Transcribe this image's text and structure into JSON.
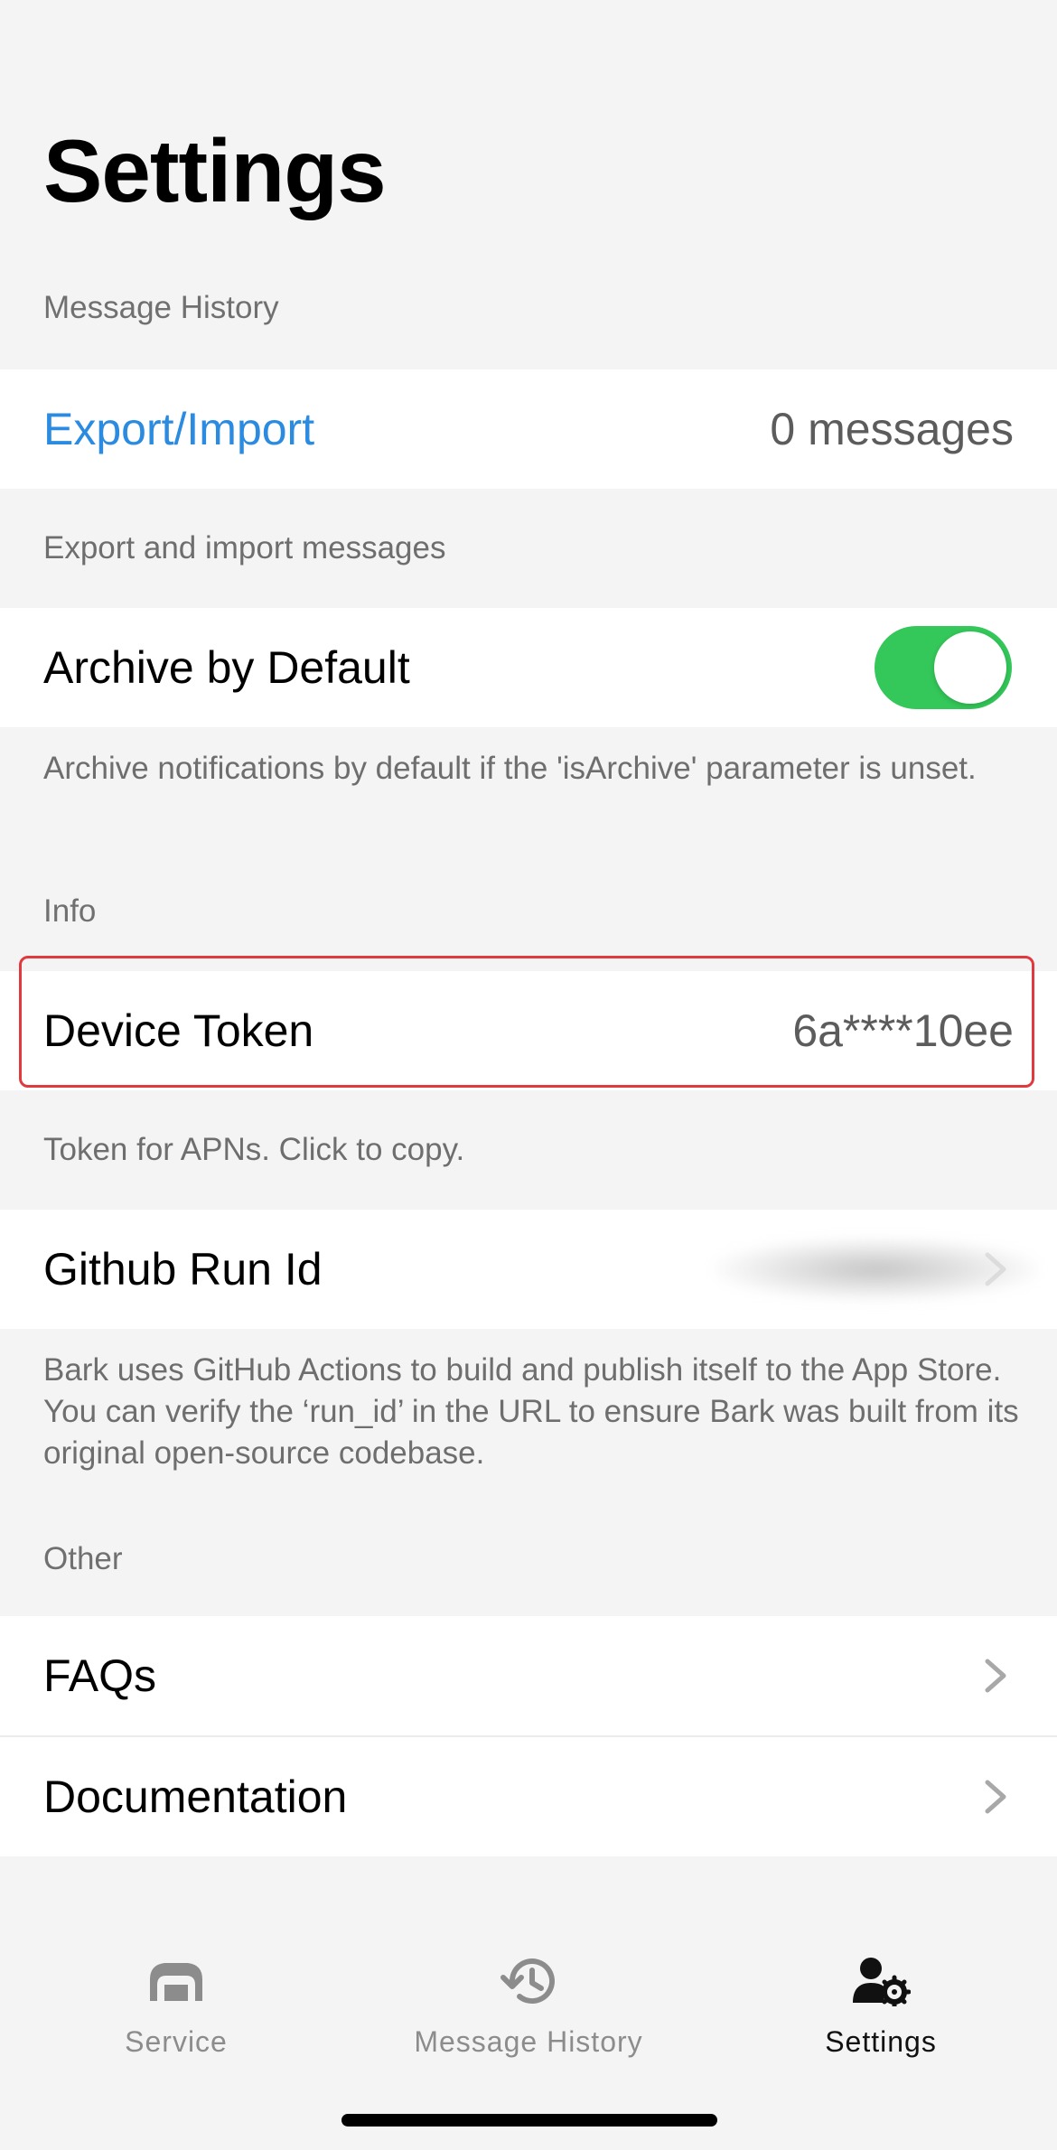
{
  "page": {
    "title": "Settings"
  },
  "sections": {
    "message_history": {
      "header": "Message History",
      "export_import_label": "Export/Import",
      "export_import_value": "0 messages",
      "export_footer": "Export and import messages",
      "archive_label": "Archive by Default",
      "archive_enabled": true,
      "archive_footer": "Archive notifications by default if the 'isArchive' parameter is unset."
    },
    "info": {
      "header": "Info",
      "device_token_label": "Device Token",
      "device_token_value": "6a****10ee",
      "device_token_footer": "Token for APNs. Click to copy.",
      "github_run_label": "Github Run Id",
      "github_run_footer": "Bark uses GitHub Actions to build and publish itself to the App Store. You can verify the ‘run_id’ in the URL to ensure Bark was built from its original open-source codebase."
    },
    "other": {
      "header": "Other",
      "faqs_label": "FAQs",
      "documentation_label": "Documentation"
    }
  },
  "tabbar": {
    "service_label": "Service",
    "message_history_label": "Message History",
    "settings_label": "Settings",
    "active": "settings"
  },
  "colors": {
    "accent_link": "#2a8be0",
    "toggle_on": "#34c759",
    "highlight_border": "#e0393e",
    "background": "#f4f4f4"
  },
  "icons": {
    "service": "service-icon",
    "message_history": "history-icon",
    "settings": "settings-icon",
    "chevron": "chevron-right-icon"
  }
}
